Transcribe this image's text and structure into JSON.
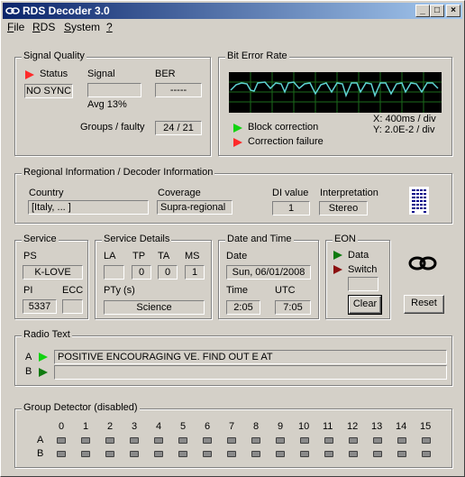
{
  "window": {
    "title": "RDS Decoder 3.0",
    "btn_min": "_",
    "btn_max": "□",
    "btn_close": "×"
  },
  "menu": [
    "File",
    "RDS",
    "System",
    "?"
  ],
  "signal_quality": {
    "title": "Signal Quality",
    "status_label": "Status",
    "status_value": "NO SYNC",
    "signal_label": "Signal",
    "signal_value": "",
    "avg_label": "Avg 13%",
    "ber_label": "BER",
    "ber_value": "-----",
    "groups_label": "Groups / faulty",
    "groups_value": "24 / 21"
  },
  "bit_error_rate": {
    "title": "Bit Error Rate",
    "block_correction": "Block correction",
    "correction_failure": "Correction failure",
    "x_scale": "X: 400ms / div",
    "y_scale": "Y: 2.0E-2 / div"
  },
  "regional": {
    "title": "Regional Information / Decoder Information",
    "country_label": "Country",
    "country_value": "[Italy, ... ]",
    "coverage_label": "Coverage",
    "coverage_value": "Supra-regional",
    "di_label": "DI value",
    "di_value": "1",
    "interp_label": "Interpretation",
    "interp_value": "Stereo"
  },
  "service": {
    "title": "Service",
    "ps_label": "PS",
    "ps_value": "K-LOVE",
    "pi_label": "PI",
    "pi_value": "5337",
    "ecc_label": "ECC",
    "ecc_value": ""
  },
  "service_details": {
    "title": "Service Details",
    "la_label": "LA",
    "la_value": "",
    "tp_label": "TP",
    "tp_value": "0",
    "ta_label": "TA",
    "ta_value": "0",
    "ms_label": "MS",
    "ms_value": "1",
    "pty_label": "PTy (s)",
    "pty_value": "Science"
  },
  "date_time": {
    "title": "Date and Time",
    "date_label": "Date",
    "date_value": "Sun, 06/01/2008",
    "time_label": "Time",
    "time_value": "2:05",
    "utc_label": "UTC",
    "utc_value": "7:05"
  },
  "eon": {
    "title": "EON",
    "data_label": "Data",
    "switch_label": "Switch",
    "switch_value": "",
    "clear_button": "Clear"
  },
  "reset_button": "Reset",
  "radio_text": {
    "title": "Radio Text",
    "row_a_label": "A",
    "row_a_value": "POSITIVE ENCOURAGING   VE. FIND OUT   E AT",
    "row_b_label": "B",
    "row_b_value": ""
  },
  "group_detector": {
    "title": "Group Detector (disabled)",
    "columns": [
      "0",
      "1",
      "2",
      "3",
      "4",
      "5",
      "6",
      "7",
      "8",
      "9",
      "10",
      "11",
      "12",
      "13",
      "14",
      "15"
    ],
    "row_a": "A",
    "row_b": "B"
  },
  "colors": {
    "led_red": "#ff2a2a",
    "led_green": "#11d311",
    "scope_trace": "#5fd3d3",
    "scope_grid": "#1b6b1b"
  }
}
